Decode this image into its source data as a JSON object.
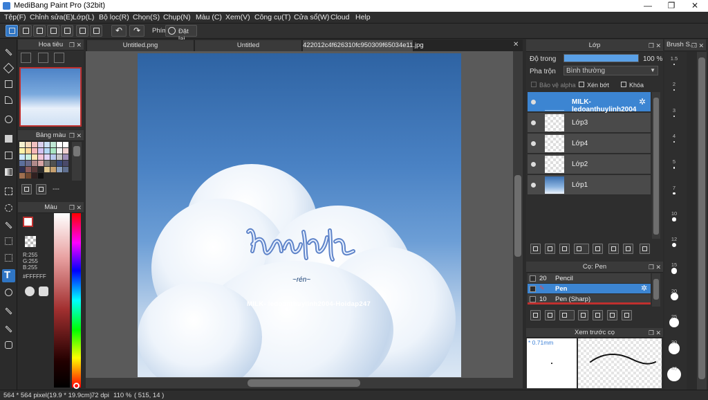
{
  "window": {
    "title": "MediBang Paint Pro (32bit)",
    "minimize": "—",
    "maximize": "❐",
    "close": "✕"
  },
  "menu": [
    "Tệp(F)",
    "Chỉnh sửa(E)",
    "Lớp(L)",
    "Bộ lọc(R)",
    "Chọn(S)",
    "Chụp(N)",
    "Màu (C)",
    "Xem(V)",
    "Công cụ(T)",
    "Cửa sổ(W)",
    "Cloud",
    "Help"
  ],
  "toolbar": {
    "shortcut_label": "Phím",
    "reset_label": "Đặt lại",
    "undo": "↶",
    "redo": "↷"
  },
  "navigator": {
    "title": "Hoa tiêu"
  },
  "palette": {
    "title": "Bảng màu",
    "dashes": "---",
    "colors": [
      "#f6f1cf",
      "#f5d9b8",
      "#f1c0c0",
      "#d8d0ee",
      "#c9e0f5",
      "#bfe7d4",
      "#ffffff",
      "#ffffff",
      "#fff3a8",
      "#ffd79a",
      "#f7b7b7",
      "#d3c1f1",
      "#b3d7f5",
      "#a8e6c2",
      "#f2f2f2",
      "#f0d0d0",
      "#cde8ff",
      "#c8f0e0",
      "#ffe6b3",
      "#f5c6da",
      "#e0d2f7",
      "#b7c9ec",
      "#c6c6c6",
      "#9f8fb8",
      "#5c6f9c",
      "#6a6a8a",
      "#b08a8a",
      "#d6a4a4",
      "#7f7f7f",
      "#515151",
      "#3a4a7a",
      "#4a4a6a",
      "#2f2f4f",
      "#8b5a5a",
      "#5a3a3a",
      "#2a2a2a",
      "#e0c890",
      "#c6a070",
      "#8aa0c0",
      "#607090",
      "#a07050",
      "#704830",
      "#302020",
      "#101010"
    ]
  },
  "color": {
    "title": "Màu",
    "r": "R:255",
    "g": "G:255",
    "b": "B:255",
    "hex": "#FFFFFF",
    "fg": "#ffffff",
    "accent": "#c0302e"
  },
  "tabs": [
    "Untitled.png",
    "Untitled",
    "422012c4f626310fc950309f65034e11.jpg"
  ],
  "canvas": {
    "signature": "MILK- ledoanthuylinh2004-Hoidap247",
    "subtitle": "~rén~"
  },
  "status": {
    "size": "564 * 564 pixel",
    "physical": "(19.9 * 19.9cm)",
    "dpi": "72 dpi",
    "zoom": "110 %",
    "coords": "( 515, 14 )"
  },
  "layers_panel": {
    "title": "Lớp",
    "opacity_label": "Độ trong",
    "opacity_value": "100 %",
    "opacity_fraction": 1.0,
    "blend_label": "Pha trộn",
    "blend_value": "Bình thường",
    "protect_alpha": "Bảo vệ alpha",
    "clipping": "Xén bớt",
    "lock": "Khóa",
    "layers": [
      "MILK- ledoanthuylinh2004",
      "Lớp3",
      "Lớp4",
      "Lớp2",
      "Lớp1"
    ]
  },
  "brush_panel": {
    "title": "Cọ: Pen",
    "brushes": [
      {
        "size": "20",
        "name": "Pencil"
      },
      {
        "size": "",
        "name": "Pen"
      },
      {
        "size": "10",
        "name": "Pen (Sharp)"
      }
    ]
  },
  "brush_preview": {
    "title": "Xem trước cọ",
    "size": "* 0.71mm"
  },
  "brush_size_panel": {
    "title": "Brush S...",
    "sizes": [
      "1.5",
      "2",
      "3",
      "4",
      "5",
      "7",
      "10",
      "12",
      "15",
      "20",
      "25",
      "30",
      "40"
    ]
  }
}
